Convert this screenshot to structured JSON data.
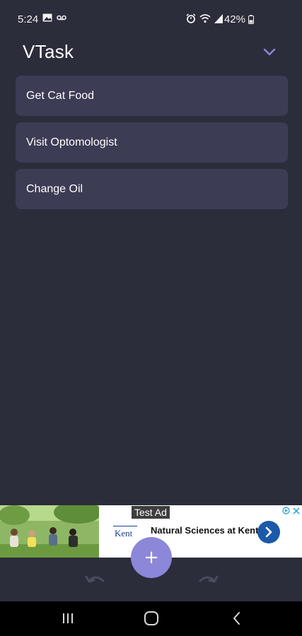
{
  "status_bar": {
    "time": "5:24",
    "battery": "42%",
    "icons": [
      "image-icon",
      "voicemail-icon",
      "alarm-icon",
      "wifi-icon",
      "signal-icon",
      "battery-icon"
    ]
  },
  "header": {
    "title": "VTask",
    "collapse_icon": "chevron-down-icon"
  },
  "tasks": [
    {
      "label": "Get Cat Food"
    },
    {
      "label": "Visit Optomologist"
    },
    {
      "label": "Change Oil"
    }
  ],
  "ad": {
    "tag": "Test Ad",
    "headline": "Natural Sciences at Kent",
    "logo_text": "Kent"
  },
  "toolbar": {
    "undo_icon": "undo-icon",
    "add_icon": "plus-icon",
    "add_glyph": "+",
    "redo_icon": "redo-icon"
  },
  "nav": {
    "icons": [
      "recents-icon",
      "home-icon",
      "back-icon"
    ]
  },
  "colors": {
    "background": "#2b2d3b",
    "task_card": "#3c3c55",
    "accent": "#8c87d8",
    "ad_button": "#1a5aa8"
  }
}
